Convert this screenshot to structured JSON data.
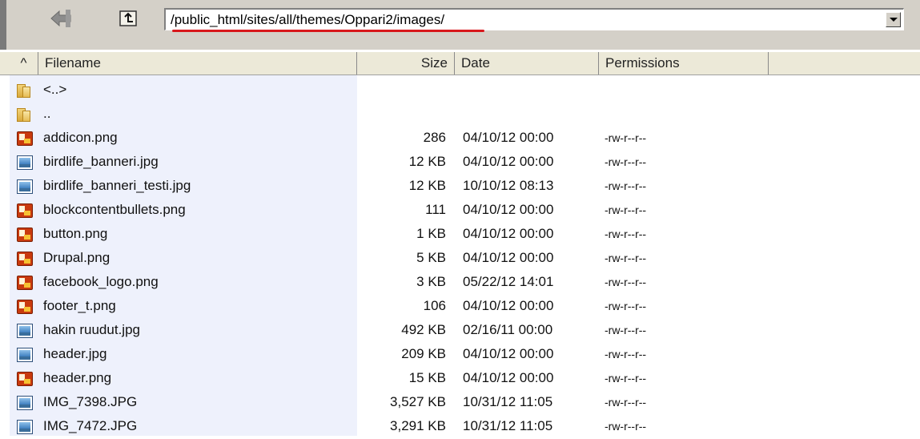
{
  "address_bar": {
    "path": "/public_html/sites/all/themes/Oppari2/images/"
  },
  "columns": {
    "sort_indicator": "^",
    "filename": "Filename",
    "size": "Size",
    "date": "Date",
    "permissions": "Permissions"
  },
  "files": [
    {
      "name": "<..>",
      "size": "",
      "date": "",
      "perm": "",
      "icon": "folder-icon"
    },
    {
      "name": "..",
      "size": "",
      "date": "",
      "perm": "",
      "icon": "folder-icon"
    },
    {
      "name": "addicon.png",
      "size": "286",
      "date": "04/10/12  00:00",
      "perm": "-rw-r--r--",
      "icon": "png-icon"
    },
    {
      "name": "birdlife_banneri.jpg",
      "size": "12 KB",
      "date": "04/10/12  00:00",
      "perm": "-rw-r--r--",
      "icon": "jpg-icon"
    },
    {
      "name": "birdlife_banneri_testi.jpg",
      "size": "12 KB",
      "date": "10/10/12  08:13",
      "perm": "-rw-r--r--",
      "icon": "jpg-icon"
    },
    {
      "name": "blockcontentbullets.png",
      "size": "111",
      "date": "04/10/12  00:00",
      "perm": "-rw-r--r--",
      "icon": "png-icon"
    },
    {
      "name": "button.png",
      "size": "1 KB",
      "date": "04/10/12  00:00",
      "perm": "-rw-r--r--",
      "icon": "png-icon"
    },
    {
      "name": "Drupal.png",
      "size": "5 KB",
      "date": "04/10/12  00:00",
      "perm": "-rw-r--r--",
      "icon": "png-icon"
    },
    {
      "name": "facebook_logo.png",
      "size": "3 KB",
      "date": "05/22/12  14:01",
      "perm": "-rw-r--r--",
      "icon": "png-icon"
    },
    {
      "name": "footer_t.png",
      "size": "106",
      "date": "04/10/12  00:00",
      "perm": "-rw-r--r--",
      "icon": "png-icon"
    },
    {
      "name": "hakin ruudut.jpg",
      "size": "492 KB",
      "date": "02/16/11  00:00",
      "perm": "-rw-r--r--",
      "icon": "jpg-icon"
    },
    {
      "name": "header.jpg",
      "size": "209 KB",
      "date": "04/10/12  00:00",
      "perm": "-rw-r--r--",
      "icon": "jpg-icon"
    },
    {
      "name": "header.png",
      "size": "15 KB",
      "date": "04/10/12  00:00",
      "perm": "-rw-r--r--",
      "icon": "png-icon"
    },
    {
      "name": "IMG_7398.JPG",
      "size": "3,527 KB",
      "date": "10/31/12  11:05",
      "perm": "-rw-r--r--",
      "icon": "jpg-icon"
    },
    {
      "name": "IMG_7472.JPG",
      "size": "3,291 KB",
      "date": "10/31/12  11:05",
      "perm": "-rw-r--r--",
      "icon": "jpg-icon"
    }
  ]
}
